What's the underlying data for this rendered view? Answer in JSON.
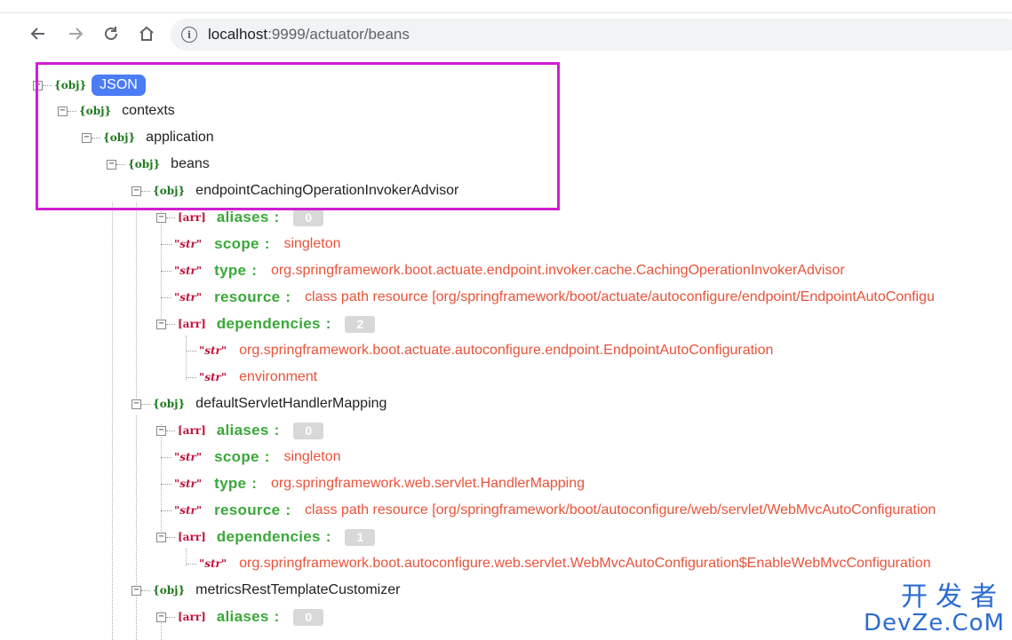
{
  "browser": {
    "back_icon": "arrow-left-icon",
    "forward_icon": "arrow-right-icon",
    "reload_icon": "reload-icon",
    "home_icon": "home-icon",
    "url_host": "localhost",
    "url_port": ":9999",
    "url_path": "/actuator/beans"
  },
  "viewer": {
    "root_type": "{obj}",
    "root_badge": "JSON",
    "contexts": "contexts",
    "application": "application",
    "beans": "beans",
    "obj_tag": "{obj}",
    "arr_tag": "[arr]",
    "str_tag": "\"str\"",
    "colon": ":"
  },
  "bean1": {
    "name": "endpointCachingOperationInvokerAdvisor",
    "aliases_key": "aliases",
    "aliases_count": "0",
    "scope_key": "scope",
    "scope_val": "singleton",
    "type_key": "type",
    "type_val": "org.springframework.boot.actuate.endpoint.invoker.cache.CachingOperationInvokerAdvisor",
    "resource_key": "resource",
    "resource_val": "class path resource [org/springframework/boot/actuate/autoconfigure/endpoint/EndpointAutoConfigu",
    "deps_key": "dependencies",
    "deps_count": "2",
    "dep1": "org.springframework.boot.actuate.autoconfigure.endpoint.EndpointAutoConfiguration",
    "dep2": "environment"
  },
  "bean2": {
    "name": "defaultServletHandlerMapping",
    "aliases_key": "aliases",
    "aliases_count": "0",
    "scope_key": "scope",
    "scope_val": "singleton",
    "type_key": "type",
    "type_val": "org.springframework.web.servlet.HandlerMapping",
    "resource_key": "resource",
    "resource_val": "class path resource [org/springframework/boot/autoconfigure/web/servlet/WebMvcAutoConfiguration",
    "deps_key": "dependencies",
    "deps_count": "1",
    "dep1": "org.springframework.boot.autoconfigure.web.servlet.WebMvcAutoConfiguration$EnableWebMvcConfiguration"
  },
  "bean3": {
    "name": "metricsRestTemplateCustomizer",
    "aliases_key": "aliases",
    "aliases_count": "0"
  },
  "watermark": {
    "cn": "开发者",
    "en": "DevZe.CoM"
  },
  "colors": {
    "highlight": "#d21ed2",
    "badge": "#4a7cf5",
    "key_green": "#3aa83a",
    "value_red": "#e8533a"
  }
}
